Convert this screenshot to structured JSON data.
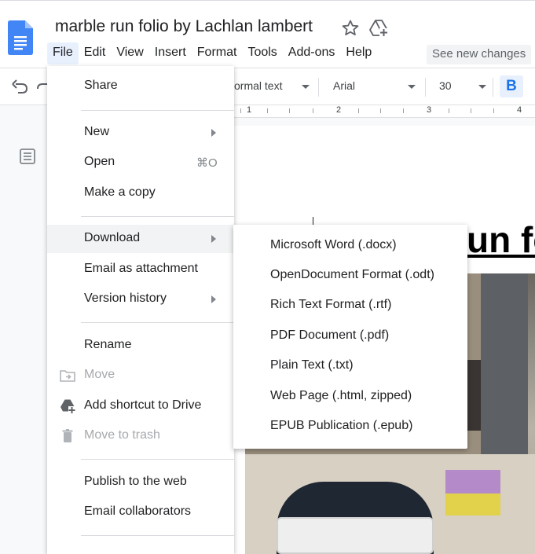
{
  "document": {
    "title": "marble run folio by Lachlan lambert",
    "heading_fragment": "un fo"
  },
  "menubar": {
    "items": [
      "File",
      "Edit",
      "View",
      "Insert",
      "Format",
      "Tools",
      "Add-ons",
      "Help"
    ],
    "see_changes": "See new changes"
  },
  "toolbar": {
    "style": "ormal text",
    "font": "Arial",
    "size": "30",
    "bold": "B"
  },
  "ruler": {
    "numbers": [
      "1",
      "2",
      "3",
      "4"
    ]
  },
  "file_menu": {
    "share": "Share",
    "new": "New",
    "open": "Open",
    "open_shortcut": "⌘O",
    "make_copy": "Make a copy",
    "download": "Download",
    "email_attachment": "Email as attachment",
    "version_history": "Version history",
    "rename": "Rename",
    "move": "Move",
    "add_shortcut": "Add shortcut to Drive",
    "move_trash": "Move to trash",
    "publish": "Publish to the web",
    "email_collaborators": "Email collaborators"
  },
  "download_menu": {
    "items": [
      "Microsoft Word (.docx)",
      "OpenDocument Format (.odt)",
      "Rich Text Format (.rtf)",
      "PDF Document (.pdf)",
      "Plain Text (.txt)",
      "Web Page (.html, zipped)",
      "EPUB Publication (.epub)"
    ]
  },
  "colors": {
    "accent": "#1a73e8",
    "docs_blue": "#4285f4",
    "menu_hover": "#f1f3f4",
    "disabled_text": "#a5a9ad"
  }
}
